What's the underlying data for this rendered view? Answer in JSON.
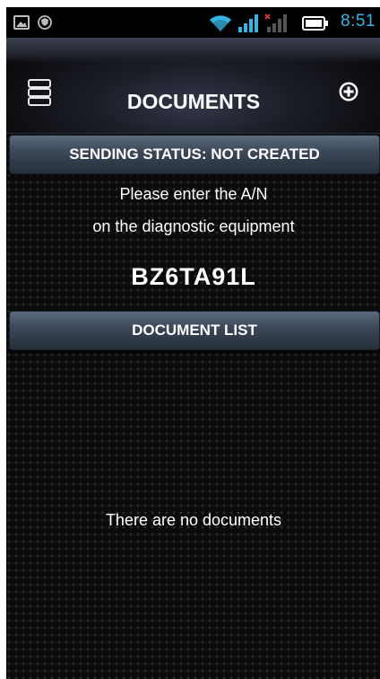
{
  "status_bar": {
    "time": "8:51",
    "time_color": "#33b5e5",
    "icons": [
      "gallery-notification-icon",
      "shield-notification-icon",
      "wifi-icon",
      "signal-icon",
      "no-signal-icon",
      "battery-icon"
    ]
  },
  "app_bar": {
    "title": "DOCUMENTS",
    "left_icon": "menu-icon",
    "right_icon": "add-circle-icon"
  },
  "sending_status": {
    "label": "SENDING STATUS: NOT CREATED"
  },
  "instructions": {
    "line1": "Please enter the A/N",
    "line2": "on the diagnostic equipment"
  },
  "code": {
    "value": "BZ6TA91L"
  },
  "document_list": {
    "header": "DOCUMENT LIST",
    "empty_message": "There are no documents"
  },
  "colors": {
    "accent": "#33b5e5",
    "background": "#0b0b0b",
    "section_bar": "#3a4656"
  }
}
